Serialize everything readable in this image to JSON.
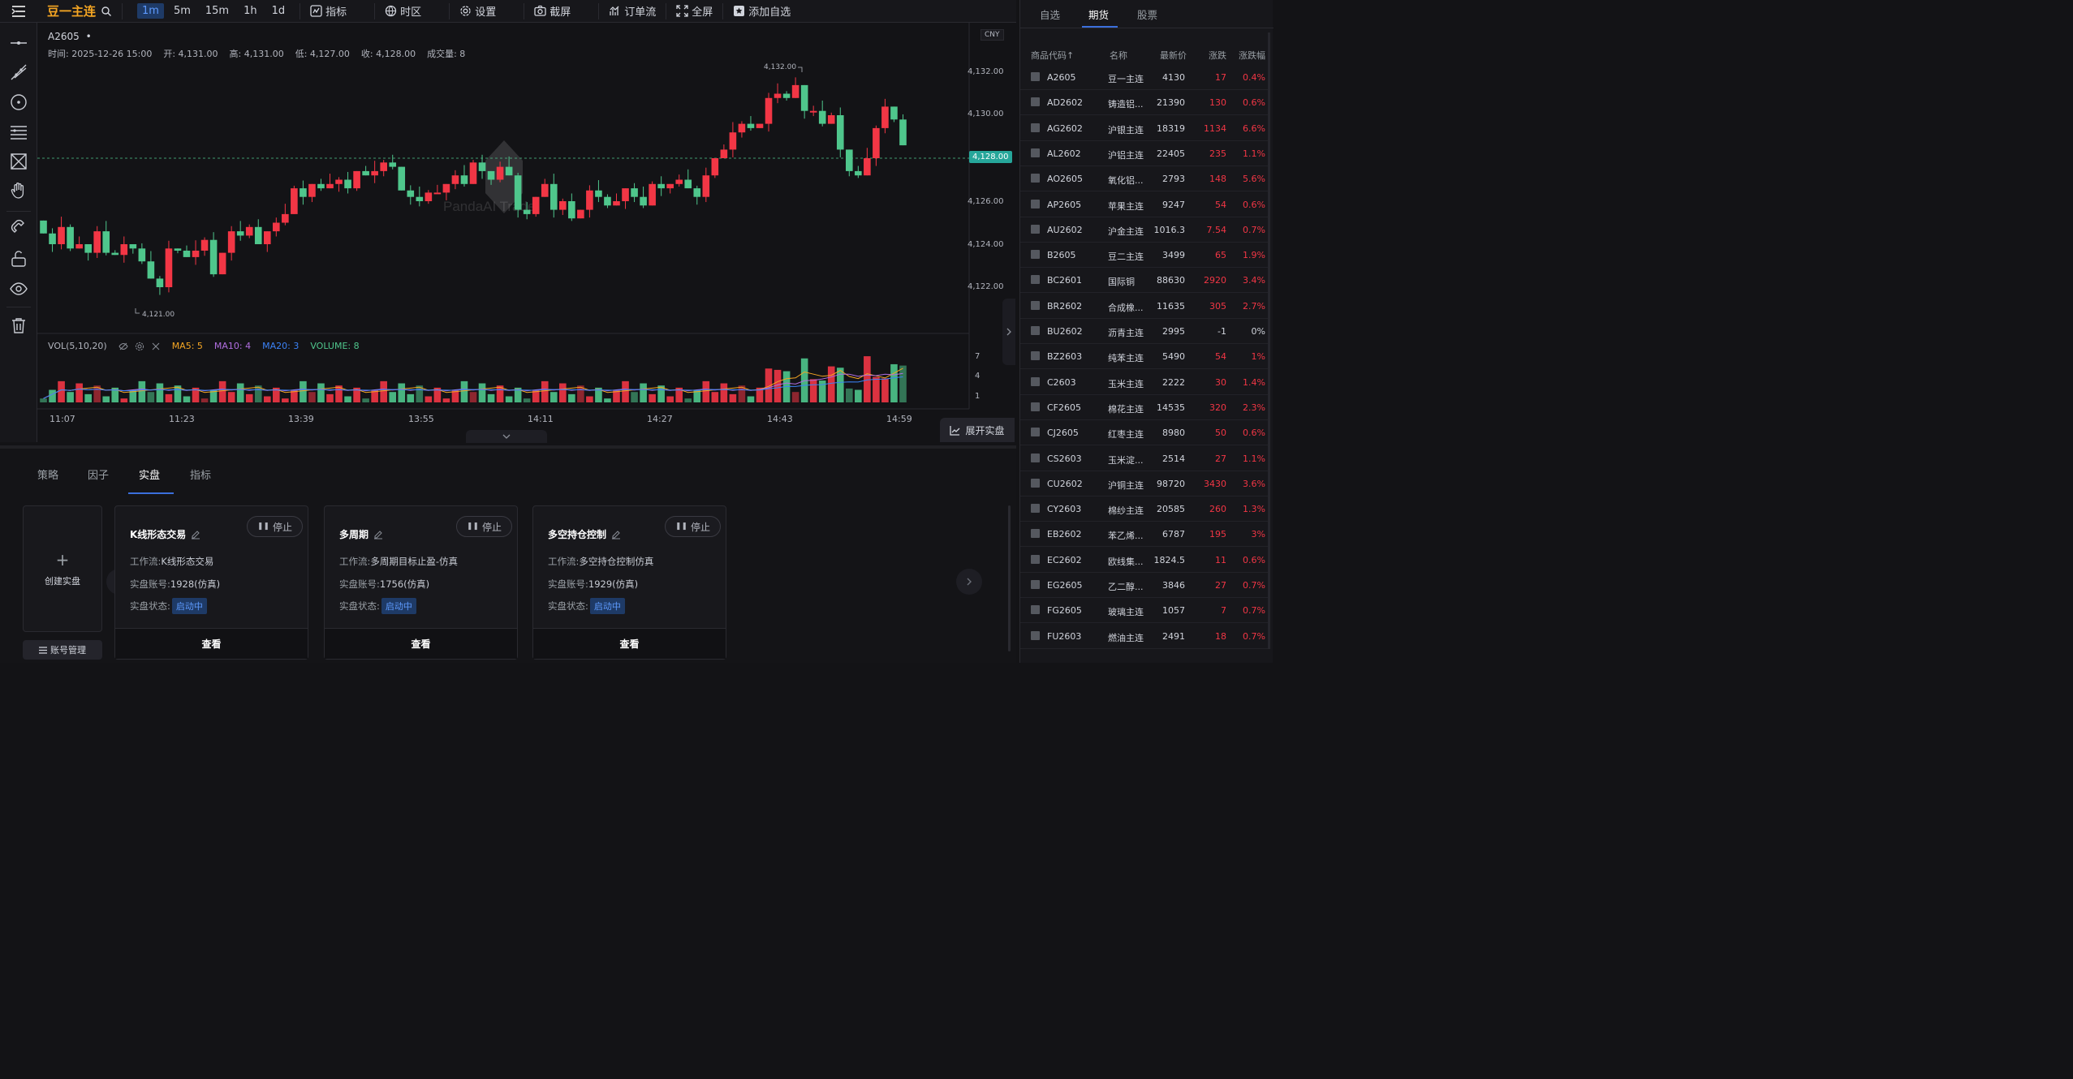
{
  "topbar": {
    "title": "豆一主连",
    "intervals": [
      "1m",
      "5m",
      "15m",
      "1h",
      "1d"
    ],
    "active_interval": "1m",
    "buttons": [
      "指标",
      "时区",
      "设置",
      "截屏",
      "订单流",
      "全屏",
      "添加自选"
    ]
  },
  "chart": {
    "symbol": "A2605",
    "dot": "•",
    "ohlc": {
      "time": "时间: 2025-12-26 15:00",
      "open": "开: 4,131.00",
      "high": "高: 4,131.00",
      "low": "低: 4,127.00",
      "close": "收: 4,128.00",
      "volume": "成交量: 8"
    },
    "currency": "CNY",
    "price_ticks": [
      "4,132.00",
      "4,130.00",
      "4,126.00",
      "4,124.00",
      "4,122.00"
    ],
    "current_price": "4,128.00",
    "high_marker": "4,132.00",
    "low_marker": "4,121.00",
    "watermark": "PandaAI Trade",
    "time_ticks": [
      "11:07",
      "11:23",
      "13:39",
      "13:55",
      "14:11",
      "14:27",
      "14:43",
      "14:59"
    ],
    "vol_legend": {
      "name": "VOL(5,10,20)",
      "ma5": "MA5: 5",
      "ma10": "MA10: 4",
      "ma20": "MA20: 3",
      "volume": "VOLUME: 8"
    },
    "vol_ticks": [
      "7",
      "4",
      "1"
    ],
    "colors": {
      "up": "#f23645",
      "down": "#4fc68c",
      "ma5": "#f5a623",
      "ma10": "#b06ee0",
      "ma20": "#3b82f6"
    },
    "expand_label": "展开实盘"
  },
  "chart_data": {
    "type": "candlestick",
    "ylim": [
      4120,
      4133
    ],
    "last_close": 4128,
    "day_high": 4132,
    "day_low": 4121
  },
  "bottom": {
    "tabs": [
      "策略",
      "因子",
      "实盘",
      "指标"
    ],
    "active_tab": "实盘",
    "create_label": "创建实盘",
    "account_label": "账号管理",
    "cards": [
      {
        "title": "K线形态交易",
        "stop": "停止",
        "workflow_label": "工作流:",
        "workflow": "K线形态交易",
        "account_label": "实盘账号:",
        "account": "1928(仿真)",
        "status_label": "实盘状态:",
        "status": "启动中",
        "view": "查看"
      },
      {
        "title": "多周期",
        "stop": "停止",
        "workflow_label": "工作流:",
        "workflow": "多周期目标止盈-仿真",
        "account_label": "实盘账号:",
        "account": "1756(仿真)",
        "status_label": "实盘状态:",
        "status": "启动中",
        "view": "查看"
      },
      {
        "title": "多空持仓控制",
        "stop": "停止",
        "workflow_label": "工作流:",
        "workflow": "多空持仓控制仿真",
        "account_label": "实盘账号:",
        "account": "1929(仿真)",
        "status_label": "实盘状态:",
        "status": "启动中",
        "view": "查看"
      }
    ]
  },
  "watchlist": {
    "tabs": [
      "自选",
      "期货",
      "股票"
    ],
    "active_tab": "期货",
    "headers": [
      "商品代码↑",
      "名称",
      "最新价",
      "涨跌",
      "涨跌幅"
    ],
    "rows": [
      {
        "code": "A2605",
        "name": "豆一主连",
        "price": "4130",
        "change": "17",
        "pct": "0.4%",
        "dir": "up"
      },
      {
        "code": "AD2602",
        "name": "铸造铝...",
        "price": "21390",
        "change": "130",
        "pct": "0.6%",
        "dir": "up"
      },
      {
        "code": "AG2602",
        "name": "沪银主连",
        "price": "18319",
        "change": "1134",
        "pct": "6.6%",
        "dir": "up"
      },
      {
        "code": "AL2602",
        "name": "沪铝主连",
        "price": "22405",
        "change": "235",
        "pct": "1.1%",
        "dir": "up"
      },
      {
        "code": "AO2605",
        "name": "氧化铝...",
        "price": "2793",
        "change": "148",
        "pct": "5.6%",
        "dir": "up"
      },
      {
        "code": "AP2605",
        "name": "苹果主连",
        "price": "9247",
        "change": "54",
        "pct": "0.6%",
        "dir": "up"
      },
      {
        "code": "AU2602",
        "name": "沪金主连",
        "price": "1016.3",
        "change": "7.54",
        "pct": "0.7%",
        "dir": "up"
      },
      {
        "code": "B2605",
        "name": "豆二主连",
        "price": "3499",
        "change": "65",
        "pct": "1.9%",
        "dir": "up"
      },
      {
        "code": "BC2601",
        "name": "国际铜",
        "price": "88630",
        "change": "2920",
        "pct": "3.4%",
        "dir": "up"
      },
      {
        "code": "BR2602",
        "name": "合成橡...",
        "price": "11635",
        "change": "305",
        "pct": "2.7%",
        "dir": "up"
      },
      {
        "code": "BU2602",
        "name": "沥青主连",
        "price": "2995",
        "change": "-1",
        "pct": "0%",
        "dir": "flat"
      },
      {
        "code": "BZ2603",
        "name": "纯苯主连",
        "price": "5490",
        "change": "54",
        "pct": "1%",
        "dir": "up"
      },
      {
        "code": "C2603",
        "name": "玉米主连",
        "price": "2222",
        "change": "30",
        "pct": "1.4%",
        "dir": "up"
      },
      {
        "code": "CF2605",
        "name": "棉花主连",
        "price": "14535",
        "change": "320",
        "pct": "2.3%",
        "dir": "up"
      },
      {
        "code": "CJ2605",
        "name": "红枣主连",
        "price": "8980",
        "change": "50",
        "pct": "0.6%",
        "dir": "up"
      },
      {
        "code": "CS2603",
        "name": "玉米淀...",
        "price": "2514",
        "change": "27",
        "pct": "1.1%",
        "dir": "up"
      },
      {
        "code": "CU2602",
        "name": "沪铜主连",
        "price": "98720",
        "change": "3430",
        "pct": "3.6%",
        "dir": "up"
      },
      {
        "code": "CY2603",
        "name": "棉纱主连",
        "price": "20585",
        "change": "260",
        "pct": "1.3%",
        "dir": "up"
      },
      {
        "code": "EB2602",
        "name": "苯乙烯...",
        "price": "6787",
        "change": "195",
        "pct": "3%",
        "dir": "up"
      },
      {
        "code": "EC2602",
        "name": "欧线集...",
        "price": "1824.5",
        "change": "11",
        "pct": "0.6%",
        "dir": "up"
      },
      {
        "code": "EG2605",
        "name": "乙二醇...",
        "price": "3846",
        "change": "27",
        "pct": "0.7%",
        "dir": "up"
      },
      {
        "code": "FG2605",
        "name": "玻璃主连",
        "price": "1057",
        "change": "7",
        "pct": "0.7%",
        "dir": "up"
      },
      {
        "code": "FU2603",
        "name": "燃油主连",
        "price": "2491",
        "change": "18",
        "pct": "0.7%",
        "dir": "up"
      }
    ]
  }
}
